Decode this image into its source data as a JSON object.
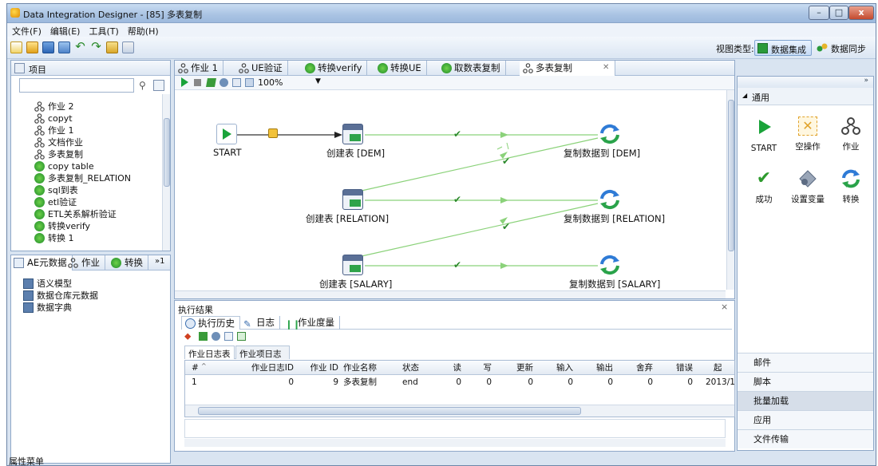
{
  "window": {
    "title": "Data Integration Designer - [85] 多表复制",
    "minimize": "–",
    "maximize": "□",
    "close": "x"
  },
  "menu": [
    {
      "label": "文件(F)"
    },
    {
      "label": "编辑(E)"
    },
    {
      "label": "工具(T)"
    },
    {
      "label": "帮助(H)"
    }
  ],
  "view_type": {
    "label": "视图类型:",
    "option1": "数据集成",
    "option2": "数据同步"
  },
  "project_panel": {
    "title": "项目",
    "items": [
      {
        "label": "作业 2",
        "icon": "job-icon"
      },
      {
        "label": "copyt",
        "icon": "job-icon"
      },
      {
        "label": "作业 1",
        "icon": "job-icon"
      },
      {
        "label": "文档作业",
        "icon": "job-icon"
      },
      {
        "label": "多表复制",
        "icon": "job-icon"
      },
      {
        "label": "copy table",
        "icon": "transform-icon"
      },
      {
        "label": "多表复制_RELATION",
        "icon": "transform-icon"
      },
      {
        "label": "sql到表",
        "icon": "transform-icon"
      },
      {
        "label": "etl验证",
        "icon": "transform-icon"
      },
      {
        "label": "ETL关系解析验证",
        "icon": "transform-icon"
      },
      {
        "label": "转换verify",
        "icon": "transform-icon"
      },
      {
        "label": "转换 1",
        "icon": "transform-icon"
      }
    ]
  },
  "meta_panel": {
    "tabs": [
      {
        "label": "AE元数据"
      },
      {
        "label": "作业"
      },
      {
        "label": "转换"
      }
    ],
    "overflow": "»1",
    "items": [
      {
        "label": "语义模型"
      },
      {
        "label": "数据仓库元数据"
      },
      {
        "label": "数据字典"
      }
    ]
  },
  "editor_tabs": [
    {
      "label": "作业 1",
      "icon": "job-icon"
    },
    {
      "label": "UE验证",
      "icon": "job-icon"
    },
    {
      "label": "转换verify",
      "icon": "transform-icon"
    },
    {
      "label": "转换UE",
      "icon": "transform-icon"
    },
    {
      "label": "取数表复制",
      "icon": "transform-icon"
    },
    {
      "label": "多表复制",
      "icon": "job-icon",
      "active": true
    }
  ],
  "canvas": {
    "zoom": "100%",
    "nodes": {
      "start": "START",
      "create1": "创建表 [DEM]",
      "copy1": "复制数据到 [DEM]",
      "create2": "创建表 [RELATION]",
      "copy2": "复制数据到 [RELATION]",
      "create3": "创建表 [SALARY]",
      "copy3": "复制数据到 [SALARY]"
    }
  },
  "results": {
    "title": "执行结果",
    "tabs": [
      {
        "label": "执行历史"
      },
      {
        "label": "日志"
      },
      {
        "label": "作业度量"
      }
    ],
    "subtabs": [
      {
        "label": "作业日志表"
      },
      {
        "label": "作业项日志表"
      }
    ],
    "columns": [
      "#",
      "作业日志ID",
      "作业 ID",
      "作业名称",
      "状态",
      "读",
      "写",
      "更新",
      "输入",
      "输出",
      "舍弃",
      "错误",
      "起"
    ],
    "rows": [
      [
        "1",
        "0",
        "9",
        "多表复制",
        "end",
        "0",
        "0",
        "0",
        "0",
        "0",
        "0",
        "0",
        "2013/1:"
      ]
    ]
  },
  "palette": {
    "section": "通用",
    "items": [
      {
        "label": "START",
        "icon": "start-icon"
      },
      {
        "label": "空操作",
        "icon": "dummy-icon"
      },
      {
        "label": "作业",
        "icon": "job-icon"
      },
      {
        "label": "成功",
        "icon": "success-icon"
      },
      {
        "label": "设置变量",
        "icon": "set-variable-icon"
      },
      {
        "label": "转换",
        "icon": "transform-icon"
      }
    ],
    "sections": [
      {
        "label": "邮件"
      },
      {
        "label": "脚本"
      },
      {
        "label": "批量加载"
      },
      {
        "label": "应用"
      },
      {
        "label": "文件传输"
      }
    ]
  },
  "status": {
    "text": "属性菜单"
  },
  "colors": {
    "accent": "#1aa33a",
    "hop": "#8bd27a",
    "transform_blue": "#2f7bd6"
  }
}
